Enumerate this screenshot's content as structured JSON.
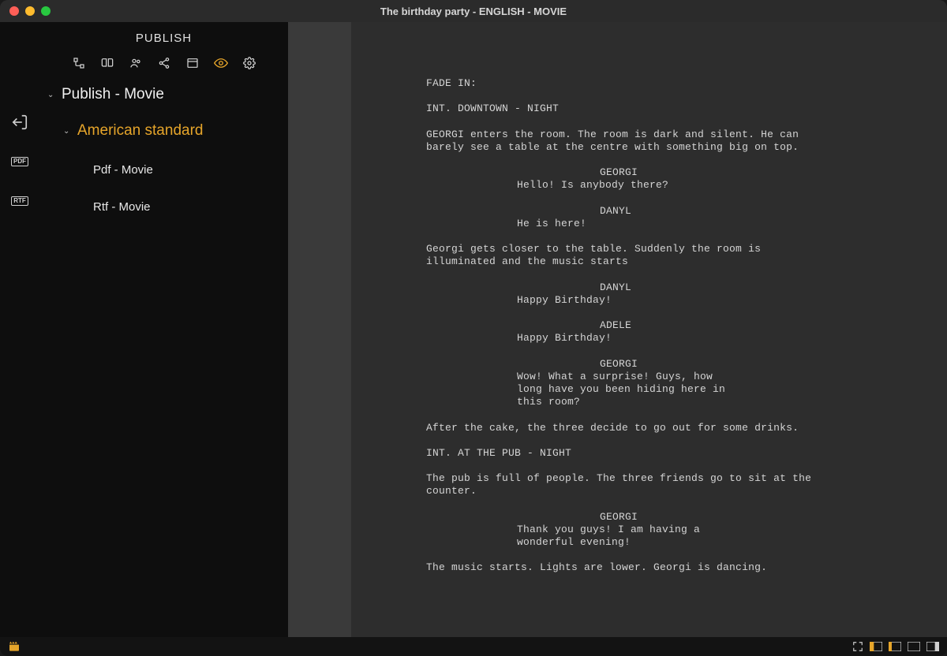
{
  "window": {
    "title": "The birthday party - ENGLISH - MOVIE"
  },
  "sidebar": {
    "title": "PUBLISH",
    "tree": {
      "root": "Publish - Movie",
      "group": "American standard",
      "items": [
        "Pdf - Movie",
        "Rtf - Movie"
      ]
    }
  },
  "rail": {
    "icons": [
      "export-icon",
      "pdf-icon",
      "rtf-icon"
    ],
    "pdf_label": "PDF",
    "rtf_label": "RTF"
  },
  "screenplay": {
    "fade_in": "FADE IN:",
    "scene1_heading": "INT. DOWNTOWN - NIGHT",
    "action1a": "GEORGI enters the room. The room is dark and silent. He can",
    "action1b": "barely see a table at the centre with something big on top.",
    "char1": "GEORGI",
    "dial1": "Hello! Is anybody there?",
    "char2": "DANYL",
    "dial2": "He is here!",
    "action2a": "Georgi gets closer to the table. Suddenly the room is",
    "action2b": "illuminated and the music starts",
    "char3": "DANYL",
    "dial3": "Happy Birthday!",
    "char4": "ADELE",
    "dial4": "Happy Birthday!",
    "char5": "GEORGI",
    "dial5a": "Wow! What a surprise! Guys, how",
    "dial5b": "long have you been hiding here in",
    "dial5c": "this room?",
    "action3": "After the cake, the three decide to go out for some drinks.",
    "scene2_heading": "INT. AT THE PUB - NIGHT",
    "action4a": "The pub is full of people. The three friends go to sit at the",
    "action4b": "counter.",
    "char6": "GEORGI",
    "dial6a": "Thank you guys! I am having a",
    "dial6b": "wonderful evening!",
    "action5": "The music starts. Lights are lower. Georgi is dancing."
  }
}
